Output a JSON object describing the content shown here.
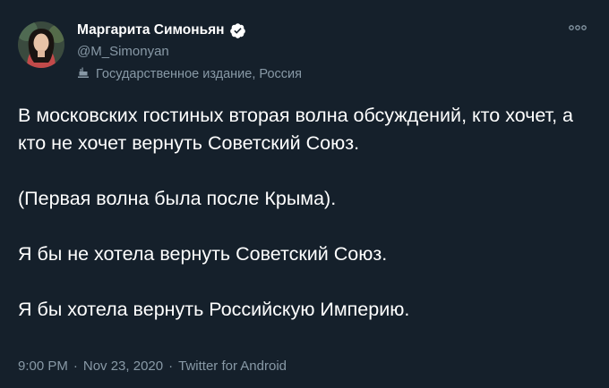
{
  "author": {
    "display_name": "Маргарита Симоньян",
    "handle": "@M_Simonyan",
    "verified": true,
    "label": "Государственное издание, Россия"
  },
  "icons": {
    "avatar": "avatar",
    "verified": "verified-badge-icon",
    "label": "state-media-flag-icon",
    "more": "more-options-icon"
  },
  "tweet": {
    "paragraphs": [
      "В московских гостиных вторая волна обсуждений, кто хочет, а кто не хочет вернуть Советский Союз.",
      "(Первая волна была после Крыма).",
      "Я бы не хотела вернуть Советский Союз.",
      "Я бы хотела вернуть Российскую Империю."
    ]
  },
  "meta": {
    "time": "9:00 PM",
    "separator": "·",
    "date": "Nov 23, 2020",
    "source": "Twitter for Android"
  },
  "colors": {
    "background": "#15202b",
    "text": "#ffffff",
    "secondary": "#8899a6"
  }
}
